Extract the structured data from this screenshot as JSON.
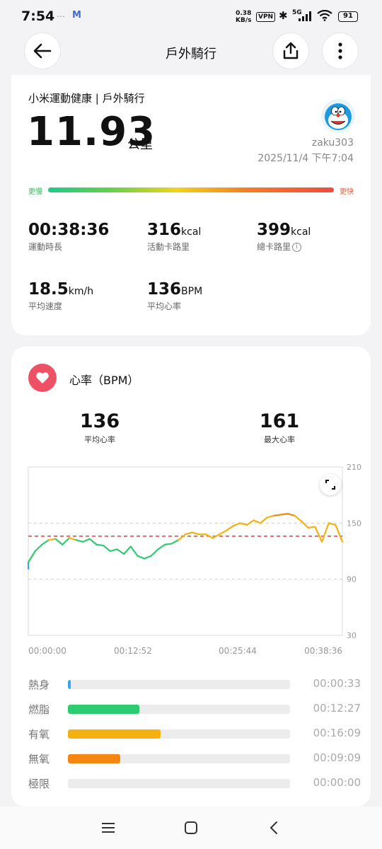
{
  "status_bar": {
    "time": "7:54",
    "speed": "0.38\nKB/s",
    "speed_value": "0.38",
    "speed_unit": "KB/s",
    "vpn": "VPN",
    "network": "5G",
    "battery": "91"
  },
  "app_bar": {
    "title": "戶外騎行"
  },
  "summary": {
    "source_title": "小米運動健康 | 戶外騎行",
    "distance": "11.93",
    "distance_unit": "公里",
    "username": "zaku303",
    "datetime": "2025/11/4 下午7:04",
    "gradient_left": "更慢",
    "gradient_right": "更快",
    "metrics": [
      {
        "value": "00:38:36",
        "unit": "",
        "label": "運動時長"
      },
      {
        "value": "316",
        "unit": "kcal",
        "label": "活動卡路里"
      },
      {
        "value": "399",
        "unit": "kcal",
        "label": "總卡路里"
      },
      {
        "value": "18.5",
        "unit": "km/h",
        "label": "平均速度"
      },
      {
        "value": "136",
        "unit": "BPM",
        "label": "平均心率"
      }
    ]
  },
  "heart_rate": {
    "title": "心率（BPM）",
    "avg_value": "136",
    "avg_label": "平均心率",
    "max_value": "161",
    "max_label": "最大心率",
    "zones": [
      {
        "name": "熱身",
        "time": "00:00:33",
        "fraction": 0.014,
        "color": "#3aa3f0"
      },
      {
        "name": "燃脂",
        "time": "00:12:27",
        "fraction": 0.322,
        "color": "#2ecc71"
      },
      {
        "name": "有氧",
        "time": "00:16:09",
        "fraction": 0.418,
        "color": "#f5b10f"
      },
      {
        "name": "無氧",
        "time": "00:09:09",
        "fraction": 0.237,
        "color": "#f5860f"
      },
      {
        "name": "極限",
        "time": "00:00:00",
        "fraction": 0.0,
        "color": "#ee4b3e"
      }
    ]
  },
  "chart_data": {
    "type": "line",
    "xlabel": "",
    "ylabel": "",
    "ylim": [
      30,
      210
    ],
    "yticks": [
      "210",
      "150",
      "90",
      "30"
    ],
    "xticks": [
      "00:00:00",
      "00:12:52",
      "00:25:44",
      "00:38:36"
    ],
    "average_line": 136,
    "grid": true,
    "x_minutes": [
      0,
      0.5,
      1,
      2,
      3,
      4,
      5,
      6,
      7,
      8,
      9,
      10,
      11,
      12,
      13,
      14,
      15,
      16,
      17,
      18,
      19,
      20,
      21,
      22,
      23,
      24,
      25,
      26,
      27,
      28,
      29,
      30,
      31,
      32,
      33,
      34,
      35,
      36,
      37,
      38,
      38.6
    ],
    "series": [
      {
        "values": [
          108,
          120,
          127,
          132,
          133,
          127,
          134,
          132,
          130,
          133,
          127,
          126,
          120,
          122,
          117,
          125,
          115,
          112,
          115,
          122,
          127,
          128,
          132,
          138,
          140,
          138,
          138,
          134,
          138,
          142,
          147,
          150,
          148,
          153,
          150,
          156,
          158,
          159,
          160,
          158,
          152,
          145,
          146,
          130,
          150,
          148,
          130
        ]
      }
    ],
    "zone_colors": {
      "fat_burn": "#2ecc71",
      "aerobic": "#f5b10f",
      "anaerobic": "#f5860f",
      "average_line": "#e64a4a"
    }
  },
  "icons": {
    "back": "back-arrow-icon",
    "share": "share-icon",
    "more": "more-vertical-icon",
    "heart": "heart-icon",
    "info": "info-icon",
    "expand": "expand-icon"
  }
}
